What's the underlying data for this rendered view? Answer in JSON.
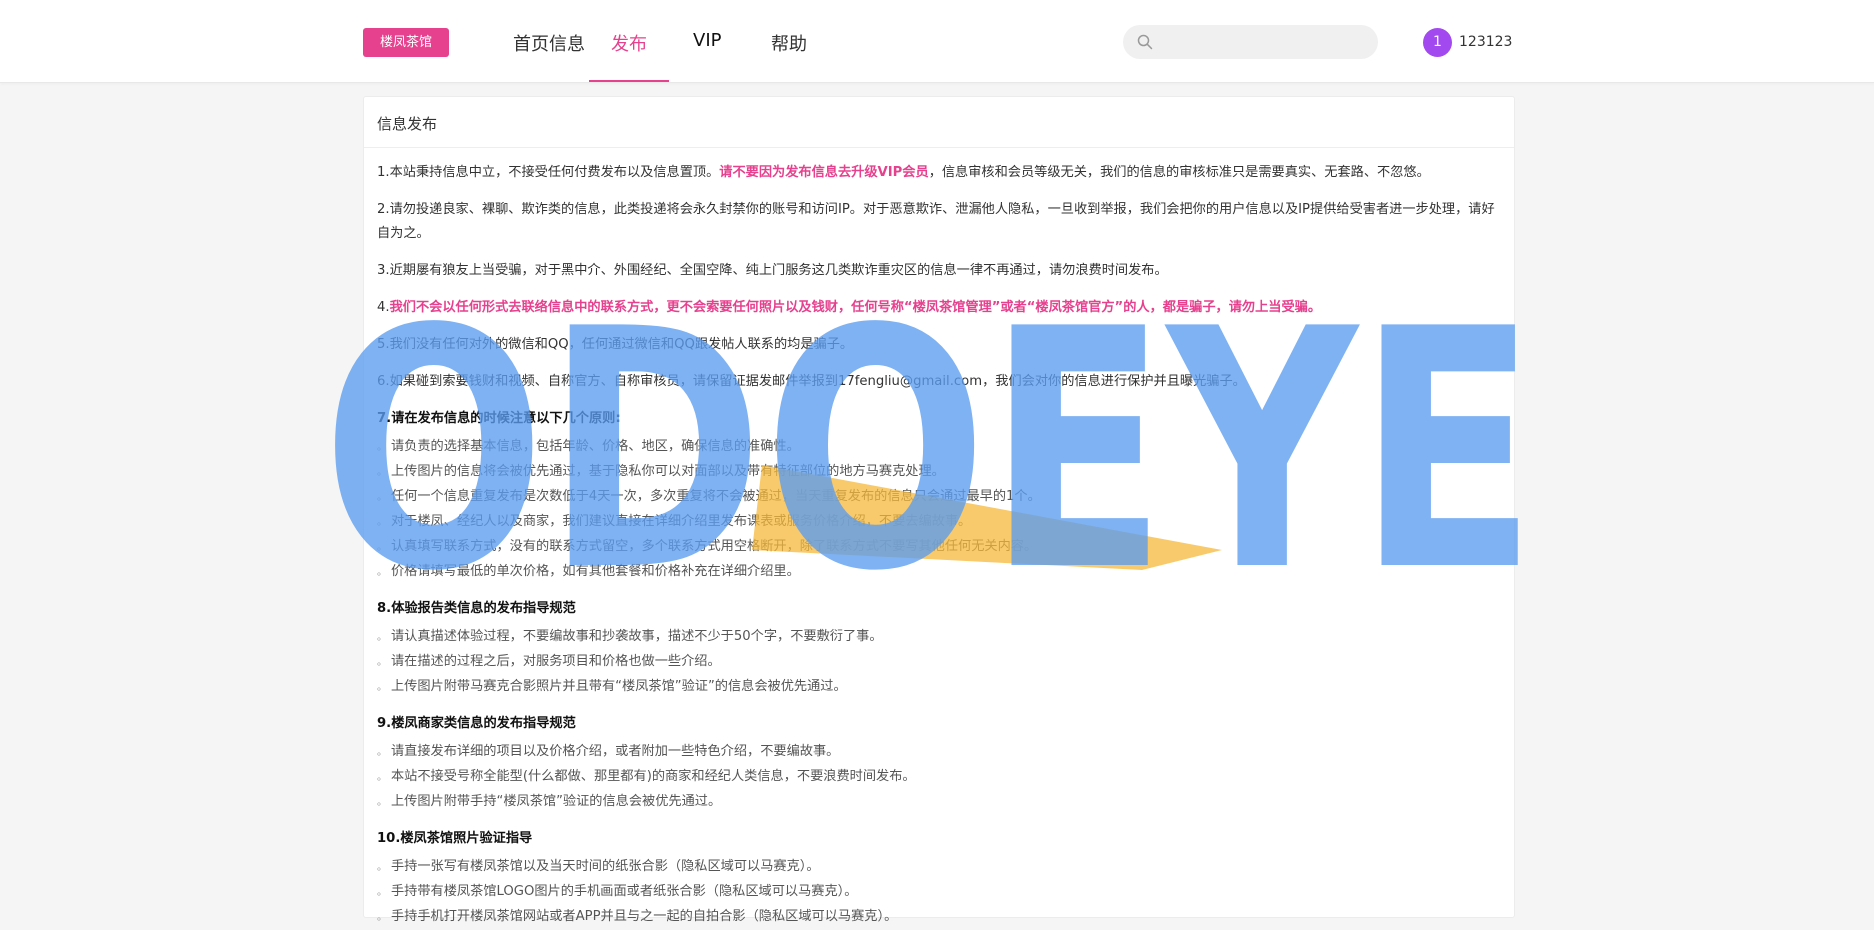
{
  "header": {
    "logo_label": "楼凤茶馆",
    "nav": [
      {
        "label": "首页信息"
      },
      {
        "label": "发布"
      },
      {
        "label": "VIP"
      },
      {
        "label": "帮助"
      }
    ],
    "search": {
      "placeholder": "",
      "value": ""
    },
    "user": {
      "avatar_text": "1",
      "name": "123123"
    }
  },
  "panel": {
    "title": "信息发布",
    "p1_a": "1.本站秉持信息中立，不接受任何付费发布以及信息置顶。",
    "p1_b": "请不要因为发布信息去升级VIP会员",
    "p1_c": "，信息审核和会员等级无关，我们的信息的审核标准只是需要真实、无套路、不忽悠。",
    "p2": "2.请勿投递良家、裸聊、欺诈类的信息，此类投递将会永久封禁你的账号和访问IP。对于恶意欺诈、泄漏他人隐私，一旦收到举报，我们会把你的用户信息以及IP提供给受害者进一步处理，请好自为之。",
    "p3": "3.近期屡有狼友上当受骗，对于黑中介、外围经纪、全国空降、纯上门服务这几类欺诈重灾区的信息一律不再通过，请勿浪费时间发布。",
    "p4_num": "4.",
    "p4": "我们不会以任何形式去联络信息中的联系方式，更不会索要任何照片以及钱财，任何号称“楼凤茶馆管理”或者“楼凤茶馆官方”的人，都是骗子，请勿上当受骗。",
    "p5": "5.我们没有任何对外的微信和QQ，任何通过微信和QQ跟发帖人联系的均是骗子。",
    "p6": "6.如果碰到索要钱财和视频、自称官方、自称审核员，请保留证据发邮件举报到17fengliu@gmail.com，我们会对你的信息进行保护并且曝光骗子。",
    "s7_num": "7.",
    "s7_title": "请在发布信息的时候注意以下几个原则:",
    "s7_items": [
      "请负责的选择基本信息，包括年龄、价格、地区，确保信息的准确性。",
      "上传图片的信息将会被优先通过，基于隐私你可以对面部以及带有特征部位的地方马赛克处理。",
      "任何一个信息重复发布是次数低于4天一次，多次重复将不会被通过，当天重复发布的信息只会通过最早的1个。",
      "对于楼凤、经纪人以及商家，我们建议直接在详细介绍里发布课表或服务价格介绍，不要去编故事。",
      "认真填写联系方式，没有的联系方式留空，多个联系方式用空格断开，除了联系方式不要写其他任何无关内容。",
      "价格请填写最低的单次价格，如有其他套餐和价格补充在详细介绍里。"
    ],
    "s8_num": "8.",
    "s8_title": "体验报告类信息的发布指导规范",
    "s8_items": [
      "请认真描述体验过程，不要编故事和抄袭故事，描述不少于50个字，不要敷衍了事。",
      "请在描述的过程之后，对服务项目和价格也做一些介绍。",
      "上传图片附带马赛克合影照片并且带有“楼凤茶馆”验证”的信息会被优先通过。"
    ],
    "s9_num": "9.",
    "s9_title": "楼凤商家类信息的发布指导规范",
    "s9_items": [
      "请直接发布详细的项目以及价格介绍，或者附加一些特色介绍，不要编故事。",
      "本站不接受号称全能型(什么都做、那里都有)的商家和经纪人类信息，不要浪费时间发布。",
      "上传图片附带手持“楼凤茶馆”验证的信息会被优先通过。"
    ],
    "s10_num": "10.",
    "s10_title": "楼凤茶馆照片验证指导",
    "s10_items": [
      "手持一张写有楼凤茶馆以及当天时间的纸张合影（隐私区域可以马赛克）。",
      "手持带有楼凤茶馆LOGO图片的手机画面或者纸张合影（隐私区域可以马赛克）。",
      "手持手机打开楼凤茶馆网站或者APP并且与之一起的自拍合影（隐私区域可以马赛克）。"
    ]
  },
  "watermark": {
    "text": "ODOEYE",
    "color_blue": "#5b9cf0",
    "color_yellow": "#f5b83a"
  }
}
